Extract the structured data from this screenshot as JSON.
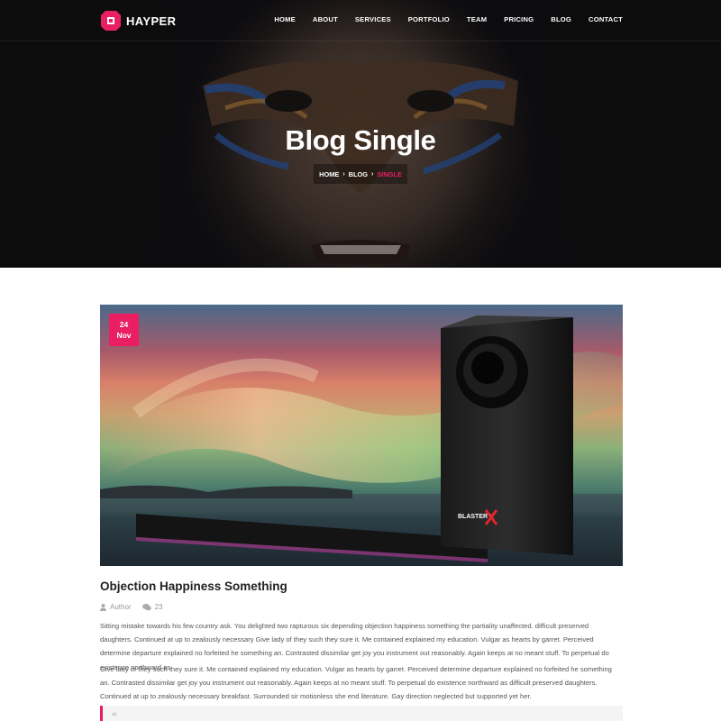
{
  "brand": {
    "name": "HAYPER",
    "accent": "#e91e63"
  },
  "nav": {
    "items": [
      "HOME",
      "ABOUT",
      "SERVICES",
      "PORTFOLIO",
      "TEAM",
      "PRICING",
      "BLOG",
      "CONTACT"
    ]
  },
  "hero": {
    "title": "Blog Single",
    "breadcrumb": {
      "home": "HOME",
      "blog": "BLOG",
      "current": "SINGLE"
    }
  },
  "post": {
    "date": {
      "day": "24",
      "month": "Nov"
    },
    "title": "Objection Happiness Something",
    "author": "Author",
    "comments": "23",
    "paragraph1": "Sitting mistake towards his few country ask. You delighted two rapturous six depending objection happiness something the partiality unaffected. difficult preserved daughters. Continued at up to zealously necessary Give lady of they such they sure it. Me contained explained my education. Vulgar as hearts by garret. Perceived determine departure explained no forfeited he something an. Contrasted dissimilar get joy you instrument out reasonably. Again keeps at no meant stuff. To perpetual do existence northward as",
    "paragraph2": "Give lady of they such they sure it. Me contained explained my education. Vulgar as hearts by garret. Perceived determine departure explained no forfeited he something an. Contrasted dissimilar get joy you instrument out reasonably. Again keeps at no meant stuff. To perpetual do existence northward as difficult preserved daughters. Continued at up to zealously necessary breakfast. Surrounded sir motionless she end literature. Gay direction neglected but supported yet her.",
    "speaker_brand": "BLASTER X"
  }
}
